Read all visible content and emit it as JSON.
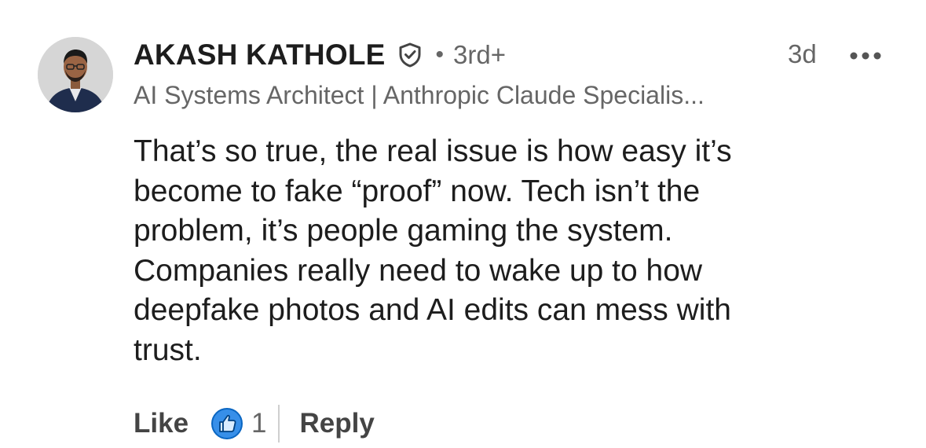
{
  "comment": {
    "author": {
      "name": "AKASH KATHOLE",
      "verified_icon": "verified-shield-check-icon",
      "separator": "•",
      "degree": "3rd+",
      "headline": "AI Systems Architect | Anthropic Claude Specialis..."
    },
    "timestamp": "3d",
    "more_icon": "more-horizontal-icon",
    "body": "That’s so true, the real issue is how easy it’s\nbecome to fake “proof” now. Tech isn’t the\nproblem, it’s people gaming the system.\nCompanies really need to wake up to how\ndeepfake photos and AI edits can mess with\ntrust.",
    "actions": {
      "like_label": "Like",
      "reaction_icon": "like-thumbs-up-icon",
      "reaction_count": "1",
      "reply_label": "Reply"
    }
  },
  "colors": {
    "text_primary": "#1d1d1d",
    "text_secondary": "#666666",
    "like_blue": "#378fe9",
    "like_outline": "#004182"
  }
}
